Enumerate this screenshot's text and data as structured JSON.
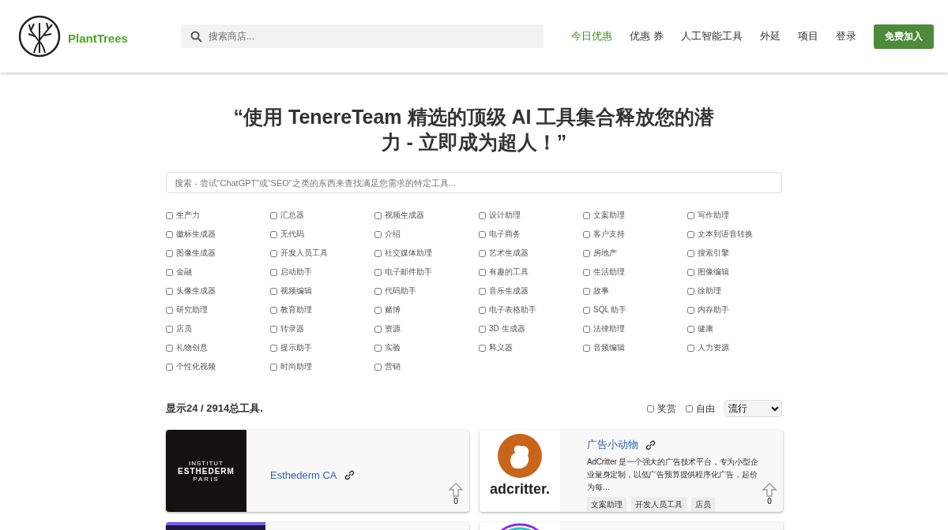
{
  "header": {
    "brand": "PlantTrees",
    "search": {
      "placeholder": "搜索商店..."
    },
    "nav": [
      {
        "label": "今日优惠",
        "selected": true
      },
      {
        "label": "优惠 券",
        "selected": false
      },
      {
        "label": "人工智能工具",
        "selected": false
      },
      {
        "label": "外延",
        "selected": false
      },
      {
        "label": "项目",
        "selected": false
      },
      {
        "label": "登录",
        "selected": false
      }
    ],
    "cta": "免费加入"
  },
  "headline": "“使用 TenereTeam 精选的顶级 AI 工具集合释放您的潜力 - 立即成为超人！”",
  "tool_search": {
    "placeholder": "搜索 - 尝试“ChatGPT”或“SEO”之类的东西来查找满足您需求的特定工具..."
  },
  "categories": [
    {
      "label": "生产力",
      "checked": false
    },
    {
      "label": "汇总器",
      "checked": false
    },
    {
      "label": "视频生成器",
      "checked": false
    },
    {
      "label": "设计助理",
      "checked": false
    },
    {
      "label": "文案助理",
      "checked": false
    },
    {
      "label": "写作助理",
      "checked": false
    },
    {
      "label": "徽标生成器",
      "checked": false
    },
    {
      "label": "无代码",
      "checked": false
    },
    {
      "label": "介绍",
      "checked": false
    },
    {
      "label": "电子商务",
      "checked": false
    },
    {
      "label": "客户支持",
      "checked": false
    },
    {
      "label": "文本到语音转换",
      "checked": false
    },
    {
      "label": "图像生成器",
      "checked": false
    },
    {
      "label": "开发人员工具",
      "checked": false
    },
    {
      "label": "社交媒体助理",
      "checked": false
    },
    {
      "label": "艺术生成器",
      "checked": false
    },
    {
      "label": "房地产",
      "checked": false
    },
    {
      "label": "搜索引擎",
      "checked": false
    },
    {
      "label": "金融",
      "checked": false
    },
    {
      "label": "启动助手",
      "checked": false
    },
    {
      "label": "电子邮件助手",
      "checked": false
    },
    {
      "label": "有趣的工具",
      "checked": false
    },
    {
      "label": "生活助理",
      "checked": false
    },
    {
      "label": "图像编辑",
      "checked": false
    },
    {
      "label": "头像生成器",
      "checked": false
    },
    {
      "label": "视频编辑",
      "checked": false
    },
    {
      "label": "代码助手",
      "checked": false
    },
    {
      "label": "音乐生成器",
      "checked": false
    },
    {
      "label": "故事",
      "checked": false
    },
    {
      "label": "徐助理",
      "checked": false
    },
    {
      "label": "研究助理",
      "checked": false
    },
    {
      "label": "教育助理",
      "checked": false
    },
    {
      "label": "赌博",
      "checked": false
    },
    {
      "label": "电子表格助手",
      "checked": false
    },
    {
      "label": "SQL 助手",
      "checked": false
    },
    {
      "label": "内存助手",
      "checked": false
    },
    {
      "label": "店员",
      "checked": false
    },
    {
      "label": "转录器",
      "checked": false
    },
    {
      "label": "资源",
      "checked": false
    },
    {
      "label": "3D 生成器",
      "checked": false
    },
    {
      "label": "法律助理",
      "checked": false
    },
    {
      "label": "健康",
      "checked": false
    },
    {
      "label": "礼物创意",
      "checked": false
    },
    {
      "label": "提示助手",
      "checked": false
    },
    {
      "label": "实验",
      "checked": false
    },
    {
      "label": "释义器",
      "checked": false
    },
    {
      "label": "音频编辑",
      "checked": false
    },
    {
      "label": "人力资源",
      "checked": false
    },
    {
      "label": "个性化视频",
      "checked": false
    },
    {
      "label": "时尚助理",
      "checked": false
    },
    {
      "label": "营销",
      "checked": false
    }
  ],
  "results": {
    "count": "显示24 / 2914总工具.",
    "filters": [
      {
        "label": "奖赏",
        "checked": false
      },
      {
        "label": "自由",
        "checked": false
      }
    ],
    "sort": "流行"
  },
  "tools": [
    {
      "kind": "dark",
      "logo_lines": [
        "INSTITUT",
        "ESTHEDERM",
        "PARIS"
      ],
      "name": "Esthederm CA",
      "votes": "0"
    },
    {
      "kind": "light",
      "logo_lines": [
        "adcritter."
      ],
      "name": "广告小动物",
      "description": "AdCritter 是一个强大的广告技术平台，专为小型企业量身定制，以低广告预算提供程序化广告，起价为每…",
      "tags": [
        "文案助理",
        "开发人员工具",
        "店员"
      ],
      "votes": "0"
    },
    {
      "kind": "purple"
    },
    {
      "kind": "ring"
    }
  ]
}
